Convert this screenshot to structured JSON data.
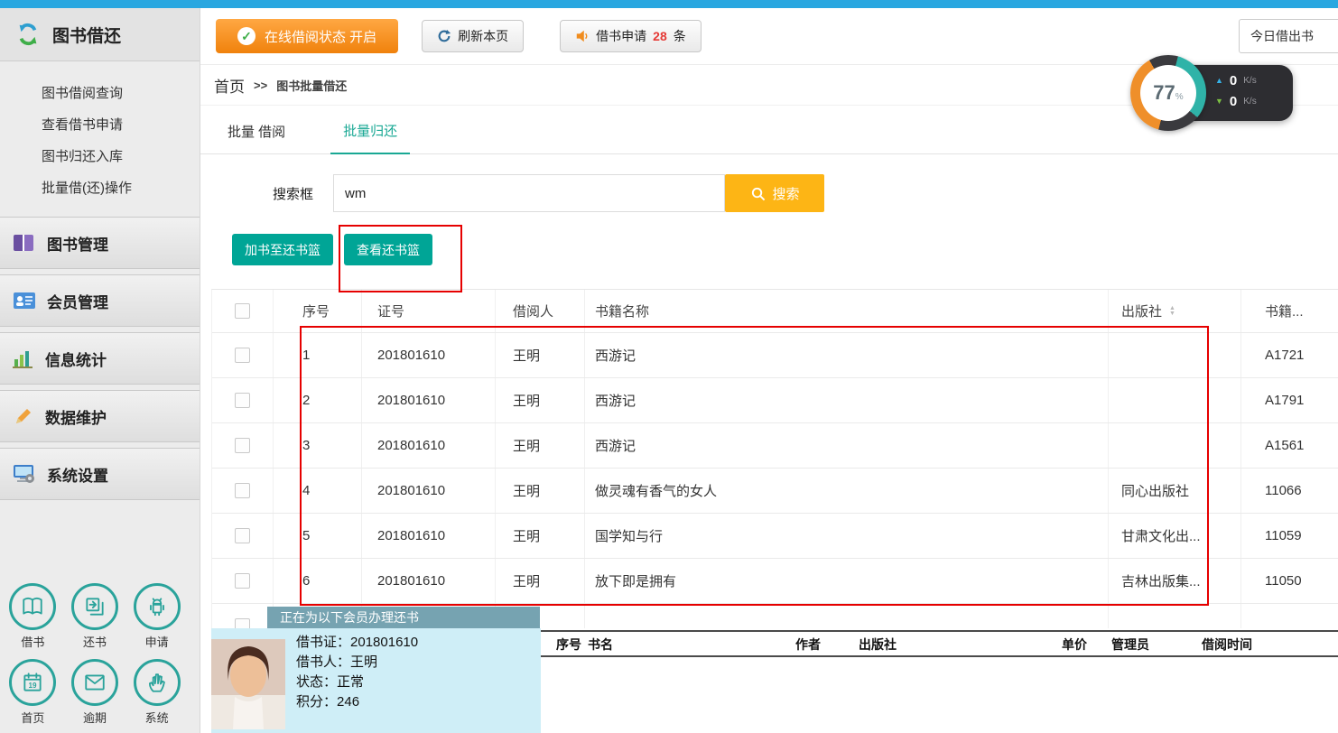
{
  "sidebar": {
    "title": "图书借还",
    "menu": [
      "图书借阅查询",
      "查看借书申请",
      "图书归还入库",
      "批量借(还)操作"
    ],
    "sections": [
      "图书管理",
      "会员管理",
      "信息统计",
      "数据维护",
      "系统设置"
    ],
    "shortcuts": [
      "借书",
      "还书",
      "申请",
      "首页",
      "逾期",
      "系统"
    ]
  },
  "toolbar": {
    "status_button": "在线借阅状态 开启",
    "refresh_button": "刷新本页",
    "apply_prefix": "借书申请",
    "apply_count": "28",
    "apply_suffix": "条",
    "today_box": "今日借出书"
  },
  "monitor": {
    "percent": "77",
    "percent_unit": "%",
    "up_value": "0",
    "up_unit": "K/s",
    "down_value": "0",
    "down_unit": "K/s"
  },
  "breadcrumb": {
    "home": "首页",
    "separator": ">>",
    "current": "图书批量借还"
  },
  "tabs": {
    "borrow": "批量 借阅",
    "return": "批量归还"
  },
  "search": {
    "label": "搜索框",
    "value": "wm",
    "button": "搜索"
  },
  "actions": {
    "add_to_basket": "加书至还书篮",
    "view_basket": "查看还书篮"
  },
  "table": {
    "headers": {
      "seq": "序号",
      "card": "证号",
      "borrower": "借阅人",
      "title": "书籍名称",
      "publisher": "出版社",
      "code": "书籍..."
    },
    "rows": [
      {
        "seq": "1",
        "card": "201801610",
        "borrower": "王明",
        "title": "西游记",
        "publisher": "",
        "code": "A1721"
      },
      {
        "seq": "2",
        "card": "201801610",
        "borrower": "王明",
        "title": "西游记",
        "publisher": "",
        "code": "A1791"
      },
      {
        "seq": "3",
        "card": "201801610",
        "borrower": "王明",
        "title": "西游记",
        "publisher": "",
        "code": "A1561"
      },
      {
        "seq": "4",
        "card": "201801610",
        "borrower": "王明",
        "title": "做灵魂有香气的女人",
        "publisher": "同心出版社",
        "code": "11066"
      },
      {
        "seq": "5",
        "card": "201801610",
        "borrower": "王明",
        "title": "国学知与行",
        "publisher": "甘肃文化出...",
        "code": "11059"
      },
      {
        "seq": "6",
        "card": "201801610",
        "borrower": "王明",
        "title": "放下即是拥有",
        "publisher": "吉林出版集...",
        "code": "11050"
      }
    ]
  },
  "member_panel": {
    "title": "正在为以下会员办理还书",
    "card_label": "借书证：",
    "card_value": "201801610",
    "name_label": "借书人：",
    "name_value": "王明",
    "status_label": "状态：",
    "status_value": "正常",
    "points_label": "积分：",
    "points_value": "246"
  },
  "return_table": {
    "headers": [
      "序号",
      "书名",
      "作者",
      "出版社",
      "单价",
      "管理员",
      "借阅时间"
    ]
  },
  "colors": {
    "topbar_blue": "#29a7e0",
    "accent_teal": "#00a596",
    "tab_active": "#19a894",
    "button_orange": "#f0820c",
    "search_yellow": "#fdb515",
    "annotation_red": "#e60000",
    "member_panel_blue": "#cfeef7",
    "member_title_bar": "#76a3b1"
  }
}
